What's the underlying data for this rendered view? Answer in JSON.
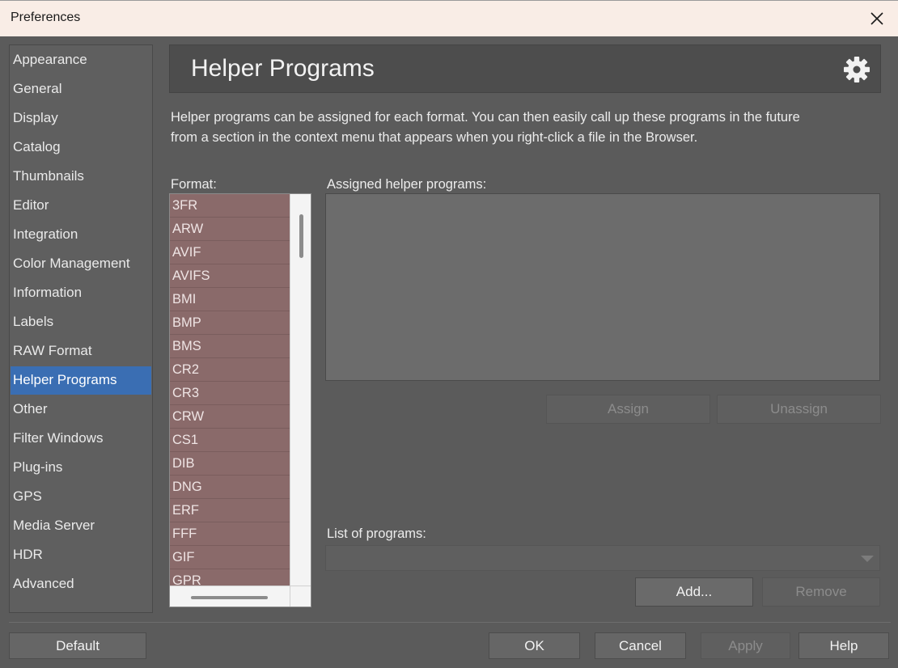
{
  "window": {
    "title": "Preferences"
  },
  "sidebar": {
    "items": [
      {
        "label": "Appearance"
      },
      {
        "label": "General"
      },
      {
        "label": "Display"
      },
      {
        "label": "Catalog"
      },
      {
        "label": "Thumbnails"
      },
      {
        "label": "Editor"
      },
      {
        "label": "Integration"
      },
      {
        "label": "Color Management"
      },
      {
        "label": "Information"
      },
      {
        "label": "Labels"
      },
      {
        "label": "RAW Format"
      },
      {
        "label": "Helper Programs"
      },
      {
        "label": "Other"
      },
      {
        "label": "Filter Windows"
      },
      {
        "label": "Plug-ins"
      },
      {
        "label": "GPS"
      },
      {
        "label": "Media Server"
      },
      {
        "label": "HDR"
      },
      {
        "label": "Advanced"
      }
    ],
    "active": "Helper Programs"
  },
  "header": {
    "title": "Helper Programs"
  },
  "description": "Helper programs can be assigned for each format. You can then easily call up these programs in the future\nfrom a section in the  context menu that appears when you right-click a file in the Browser.",
  "format": {
    "label": "Format:",
    "items": [
      "3FR",
      "ARW",
      "AVIF",
      "AVIFS",
      "BMI",
      "BMP",
      "BMS",
      "CR2",
      "CR3",
      "CRW",
      "CS1",
      "DIB",
      "DNG",
      "ERF",
      "FFF",
      "GIF",
      "GPR"
    ]
  },
  "assigned": {
    "label": "Assigned helper programs:",
    "assign": "Assign",
    "unassign": "Unassign"
  },
  "programs": {
    "label": "List of programs:",
    "add": "Add...",
    "remove": "Remove"
  },
  "footer": {
    "default": "Default",
    "ok": "OK",
    "cancel": "Cancel",
    "apply": "Apply",
    "help": "Help"
  }
}
